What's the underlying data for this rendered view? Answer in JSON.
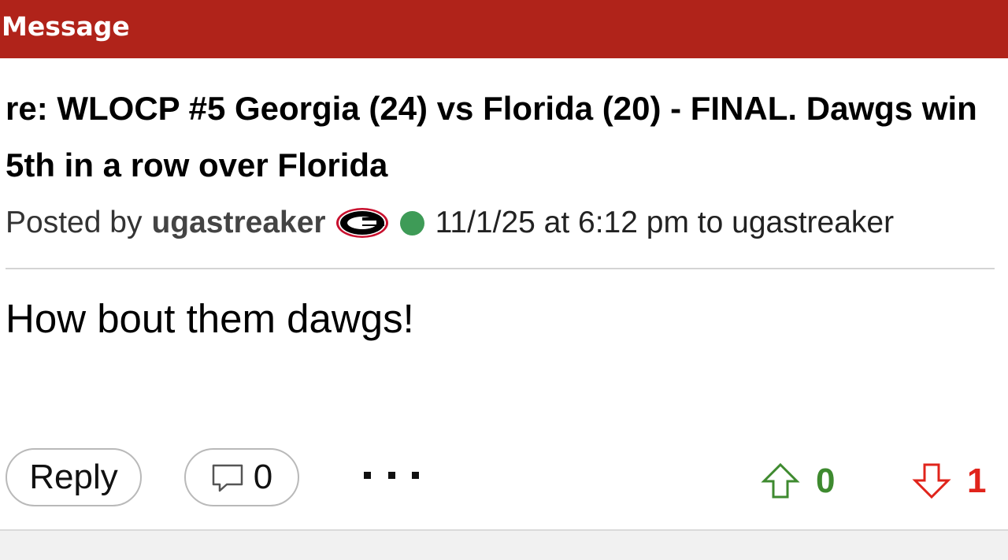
{
  "header": {
    "title": "Message",
    "color": "#b0231a"
  },
  "post": {
    "title": "re: WLOCP #5 Georgia (24) vs Florida (20) - FINAL. Dawgs win 5th in a row over Florida",
    "meta": {
      "prefix": "Posted by",
      "username": "ugastreaker",
      "team_icon": "georgia-g-logo",
      "online_status": "online",
      "timestamp": "11/1/25 at 6:12 pm to ugastreaker"
    },
    "body": "How bout them dawgs!"
  },
  "actions": {
    "reply_label": "Reply",
    "comment_count": "0",
    "comment_icon": "speech-bubble-icon",
    "more_icon": "ellipsis-icon"
  },
  "votes": {
    "up_count": "0",
    "up_color": "#3e8a2f",
    "down_count": "1",
    "down_color": "#e0241b"
  }
}
